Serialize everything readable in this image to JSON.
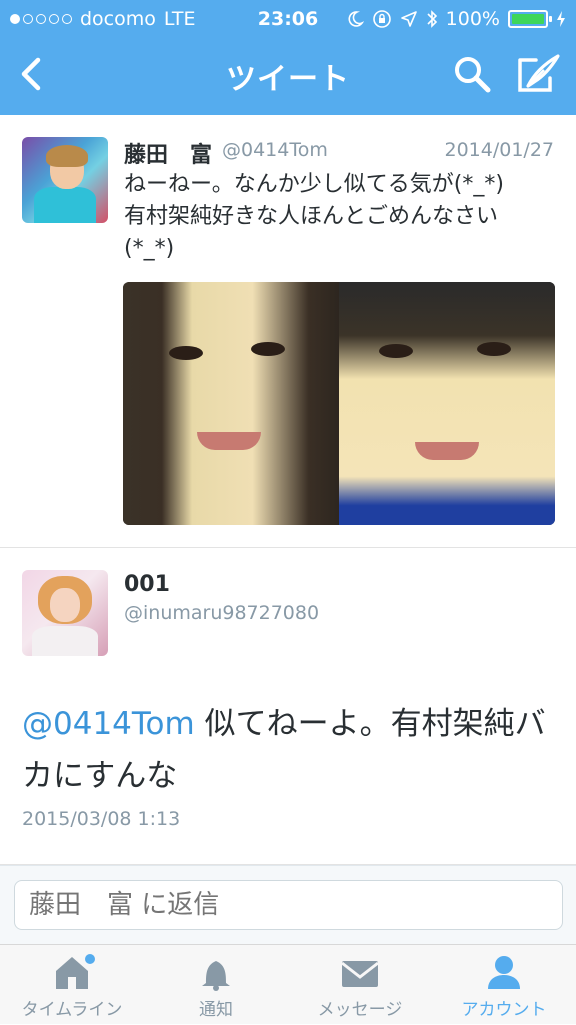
{
  "status_bar": {
    "carrier": "docomo",
    "network": "LTE",
    "time": "23:06",
    "battery": "100%",
    "signal_dots_filled": 1,
    "signal_dots_total": 5
  },
  "nav": {
    "title": "ツイート",
    "icons": [
      "back-chevron-icon",
      "search-icon",
      "compose-icon"
    ]
  },
  "tweet": {
    "name": "藤田　富",
    "handle": "@0414Tom",
    "date": "2014/01/27",
    "text_line1": "ねーねー。なんか少し似てる気が(*_*)",
    "text_line2": "有村架純好きな人ほんとごめんなさい",
    "text_line3": "(*_*)"
  },
  "reply_tweet": {
    "name": "001",
    "handle": "@inumaru98727080",
    "mention": "@0414Tom",
    "text": " 似てねーよ。有村架純バカにすんな",
    "timestamp": "2015/03/08 1:13"
  },
  "reply_bar": {
    "placeholder": "藤田　富 に返信"
  },
  "tabs": [
    {
      "label": "タイムライン",
      "icon": "home-icon",
      "active": false
    },
    {
      "label": "通知",
      "icon": "bell-icon",
      "active": false
    },
    {
      "label": "メッセージ",
      "icon": "envelope-icon",
      "active": false
    },
    {
      "label": "アカウント",
      "icon": "person-icon",
      "active": true
    }
  ],
  "colors": {
    "twitter_blue": "#55acee",
    "link_blue": "#3b94d9",
    "gray_text": "#8899a6",
    "battery_green": "#3fd65a"
  }
}
